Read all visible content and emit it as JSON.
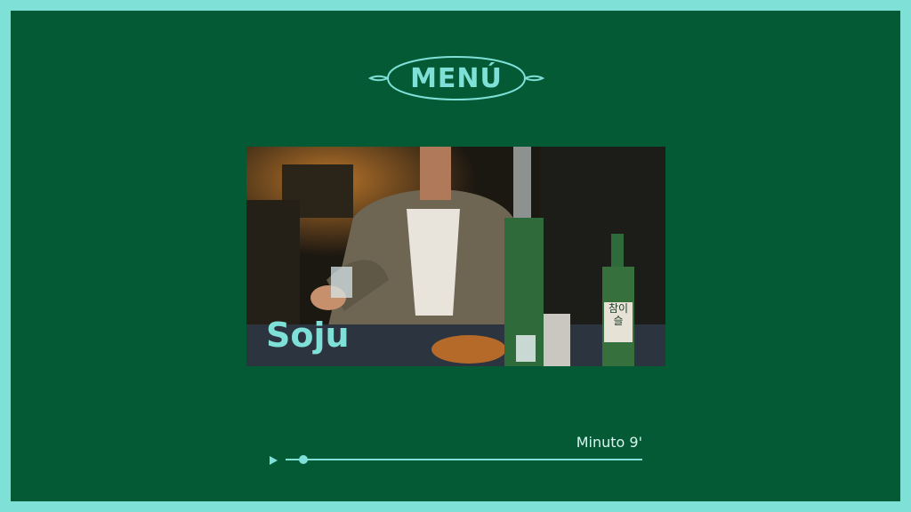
{
  "header": {
    "title": "MENÚ"
  },
  "media": {
    "caption": "Soju",
    "bottle_label": "참이슬",
    "scene": "photo"
  },
  "player": {
    "time_label": "Minuto 9'",
    "progress": 0.05
  },
  "colors": {
    "background": "#035a34",
    "accent": "#7fe0d8"
  },
  "icons": {
    "play": "play-icon"
  }
}
